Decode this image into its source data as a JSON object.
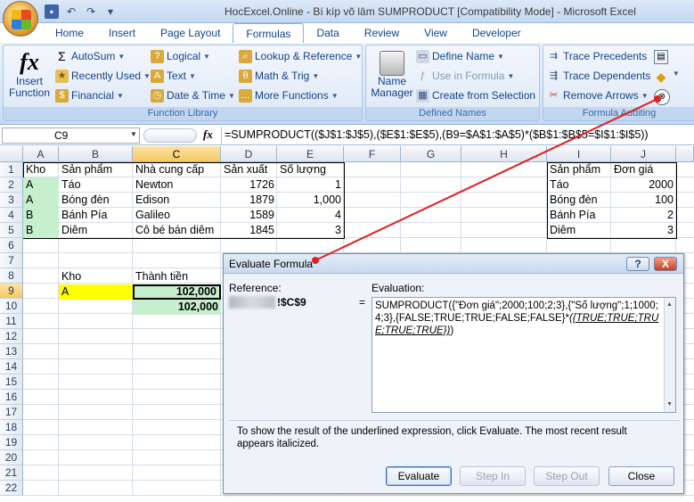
{
  "window": {
    "title": "HocExcel.Online - Bí kíp võ lâm SUMPRODUCT  [Compatibility Mode] - Microsoft Excel"
  },
  "tabs": [
    "Home",
    "Insert",
    "Page Layout",
    "Formulas",
    "Data",
    "Review",
    "View",
    "Developer"
  ],
  "active_tab": "Formulas",
  "ribbon": {
    "function_library": {
      "label": "Function Library",
      "insert_function_line1": "Insert",
      "insert_function_line2": "Function",
      "autosum": "AutoSum",
      "recently_used": "Recently Used",
      "financial": "Financial",
      "logical": "Logical",
      "text": "Text",
      "date_time": "Date & Time",
      "lookup": "Lookup & Reference",
      "math": "Math & Trig",
      "more": "More Functions"
    },
    "defined_names": {
      "label": "Defined Names",
      "name_manager_line1": "Name",
      "name_manager_line2": "Manager",
      "define_name": "Define Name",
      "use_in_formula": "Use in Formula",
      "create_from_selection": "Create from Selection"
    },
    "formula_auditing": {
      "label": "Formula Auditing",
      "trace_precedents": "Trace Precedents",
      "trace_dependents": "Trace Dependents",
      "remove_arrows": "Remove Arrows"
    }
  },
  "formula_bar": {
    "name_box": "C9",
    "fx": "fx",
    "formula": "=SUMPRODUCT(($J$1:$J$5),($E$1:$E$5),(B9=$A$1:$A$5)*($B$1:$B$5=$I$1:$I$5))"
  },
  "columns": [
    "A",
    "B",
    "C",
    "D",
    "E",
    "F",
    "G",
    "H",
    "I",
    "J"
  ],
  "selected_column": "C",
  "rows": [
    "1",
    "2",
    "3",
    "4",
    "5",
    "6",
    "7",
    "8",
    "9",
    "10",
    "11",
    "12",
    "13",
    "14",
    "15",
    "16",
    "17",
    "18",
    "19",
    "20",
    "21",
    "22"
  ],
  "selected_row": "9",
  "table1": {
    "headers": [
      "Kho",
      "Sản phẩm",
      "Nhà cung cấp",
      "Sản xuất",
      "Số lượng"
    ],
    "rows": [
      [
        "A",
        "Táo",
        "Newton",
        "1726",
        "1"
      ],
      [
        "A",
        "Bóng đèn",
        "Edison",
        "1879",
        "1,000"
      ],
      [
        "B",
        "Bánh Pía",
        "Galileo",
        "1589",
        "4"
      ],
      [
        "B",
        "Diêm",
        "Cô bé bán diêm",
        "1845",
        "3"
      ]
    ]
  },
  "table2": {
    "headers": [
      "Sản phẩm",
      "Đơn giá"
    ],
    "rows": [
      [
        "Táo",
        "2000"
      ],
      [
        "Bóng đèn",
        "100"
      ],
      [
        "Bánh Pía",
        "2"
      ],
      [
        "Diêm",
        "3"
      ]
    ]
  },
  "lookup": {
    "kho_label": "Kho",
    "thanh_tien_label": "Thành tiền",
    "kho_value": "A",
    "result1": "102,000",
    "result2": "102,000"
  },
  "dialog": {
    "title": "Evaluate Formula",
    "help": "?",
    "close_x": "X",
    "reference_label": "Reference:",
    "reference_value": "!$C$9",
    "equals": "=",
    "evaluation_label": "Evaluation:",
    "evaluation_plain": "SUMPRODUCT({\"Đơn giá\";2000;100;2;3},{\"Số lượng\";1;1000;4;3},{FALSE;TRUE;TRUE;FALSE;FALSE}*",
    "evaluation_underlined": "({TRUE;TRUE;TRUE;TRUE;TRUE})",
    "evaluation_tail": ")",
    "hint": "To show the result of the underlined expression, click Evaluate.  The most recent result appears italicized.",
    "buttons": {
      "evaluate": "Evaluate",
      "step_in": "Step In",
      "step_out": "Step Out",
      "close": "Close"
    }
  }
}
